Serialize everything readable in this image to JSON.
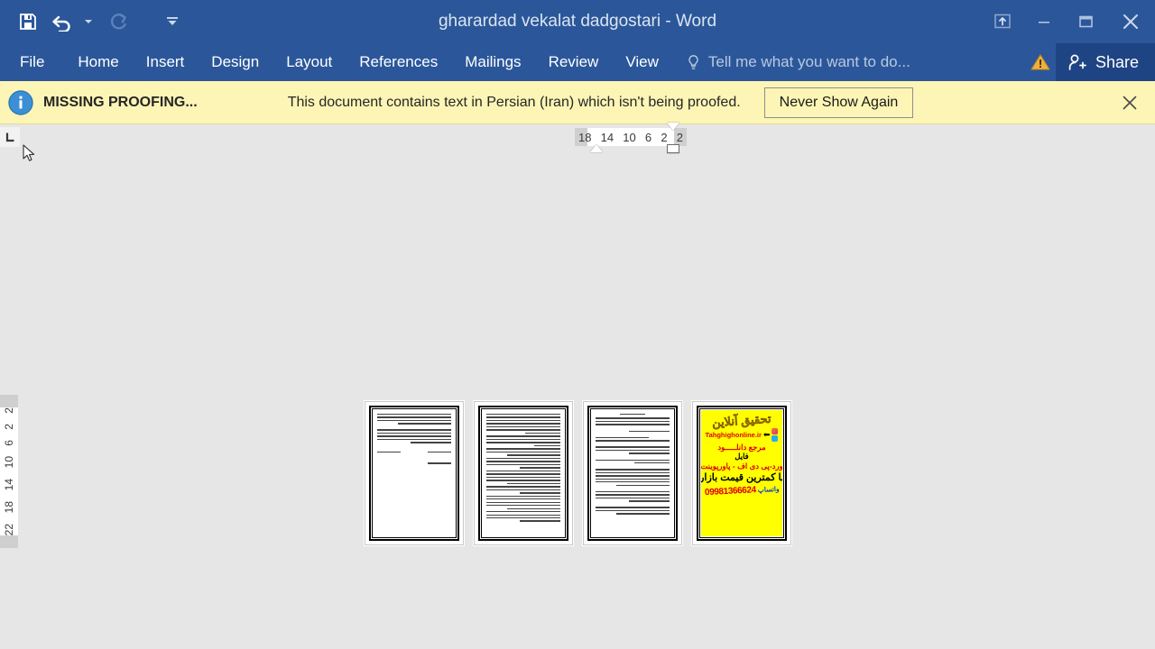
{
  "window": {
    "title": "gharardad vekalat dadgostari - Word",
    "controls": {
      "ribbon_display_options": "Ribbon Display Options",
      "minimize": "Minimize",
      "restore": "Restore Down",
      "close": "Close"
    }
  },
  "quick_access": {
    "items": [
      {
        "name": "save",
        "label": "Save"
      },
      {
        "name": "undo",
        "label": "Undo"
      },
      {
        "name": "undo-dropdown",
        "label": "Undo options"
      },
      {
        "name": "redo",
        "label": "Repeat"
      },
      {
        "name": "customize",
        "label": "Customize Quick Access Toolbar"
      }
    ]
  },
  "ribbon": {
    "tabs": [
      {
        "label": "File"
      },
      {
        "label": "Home"
      },
      {
        "label": "Insert"
      },
      {
        "label": "Design"
      },
      {
        "label": "Layout"
      },
      {
        "label": "References"
      },
      {
        "label": "Mailings"
      },
      {
        "label": "Review"
      },
      {
        "label": "View"
      }
    ],
    "tell_me": "Tell me what you want to do...",
    "warning": "Warning",
    "share": "Share"
  },
  "message_bar": {
    "icon": "info-icon",
    "label": "MISSING PROOFING...",
    "text": "This document contains text in Persian (Iran) which isn't being proofed.",
    "button": "Never Show Again",
    "close": "Close"
  },
  "rulers": {
    "tab_selector": "Left Tab",
    "horizontal_ticks": [
      "18",
      "14",
      "10",
      "6",
      "2",
      "2"
    ],
    "vertical_ticks": [
      "2",
      "2",
      "6",
      "10",
      "14",
      "18",
      "22"
    ]
  },
  "document": {
    "zoom_view": "multiple-pages",
    "pages": [
      {
        "index": 1,
        "name": "page-thumbnail-1",
        "type": "text"
      },
      {
        "index": 2,
        "name": "page-thumbnail-2",
        "type": "text"
      },
      {
        "index": 3,
        "name": "page-thumbnail-3",
        "type": "form"
      },
      {
        "index": 4,
        "name": "page-thumbnail-4",
        "type": "advertisement"
      }
    ],
    "ad_page": {
      "title": "تحقیق آنلاین",
      "site": "Tahghighonline.ir",
      "arrow": "⬅",
      "line_red_1": "مرجع دانلـــــود",
      "line_black_1": "فایل",
      "line_red_2": "ورد-پی دی اف - پاورپوینت",
      "line_big": "با کمترین قیمت بازار",
      "phone": "09981366624",
      "whatsapp": "واتساپ",
      "colors": {
        "background": "#ffff00",
        "title": "#e8a400",
        "red": "#e00000",
        "black": "#000000",
        "blue": "#1040c0"
      }
    }
  },
  "colors": {
    "titlebar": "#2b579a",
    "share_button": "#1f4483",
    "message_bar": "#fdf5b5",
    "canvas": "#e6e6e6"
  }
}
